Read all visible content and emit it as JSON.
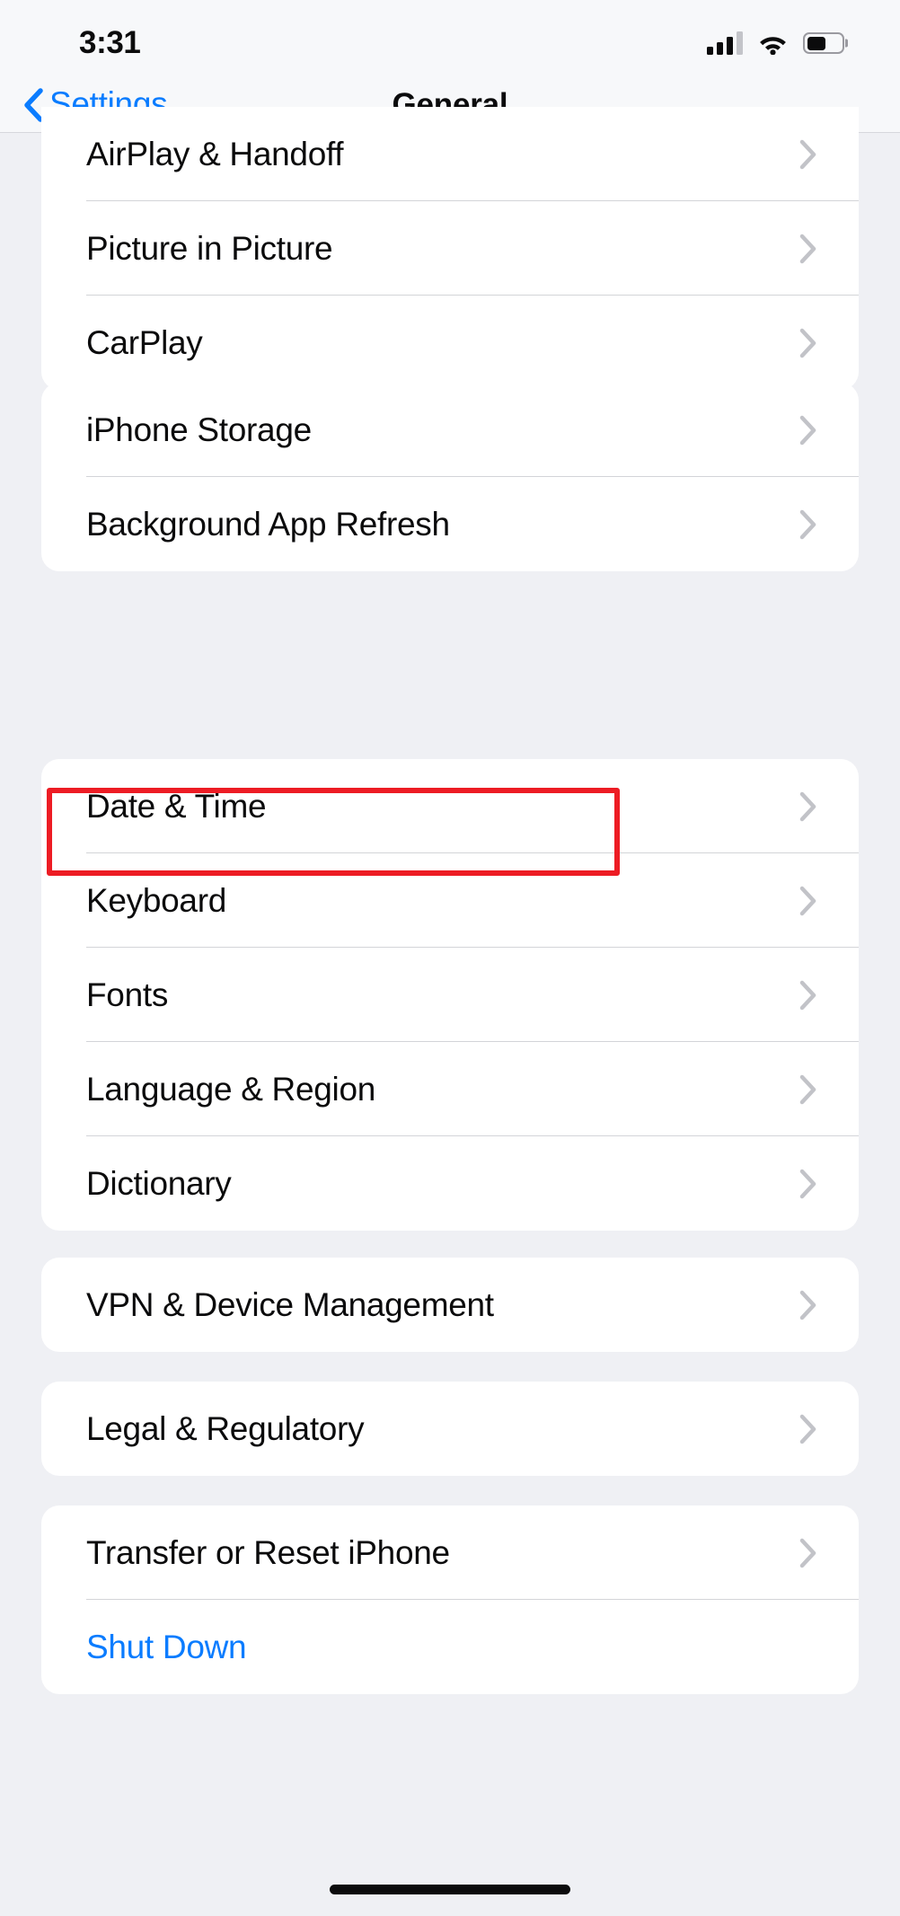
{
  "status_bar": {
    "time": "3:31",
    "cellular_icon": "cellular-signal-icon",
    "cellular_bars_filled": 3,
    "cellular_bars_total": 4,
    "wifi_icon": "wifi-icon",
    "battery_icon": "battery-icon",
    "battery_percent": 55
  },
  "nav": {
    "back_icon": "chevron-left-icon",
    "back_label": "Settings",
    "title": "General"
  },
  "colors": {
    "accent_blue": "#0a7cff",
    "highlight_red": "#ed1c24",
    "page_background": "#eff0f4",
    "card_background": "#ffffff"
  },
  "highlight": {
    "target_label": "Date & Time",
    "color": "#ed1c24"
  },
  "groups": [
    {
      "name": "media-group",
      "rows": [
        {
          "label": "AirPlay & Handoff",
          "accessory": "chevron-right-icon",
          "style": "default"
        },
        {
          "label": "Picture in Picture",
          "accessory": "chevron-right-icon",
          "style": "default"
        },
        {
          "label": "CarPlay",
          "accessory": "chevron-right-icon",
          "style": "default"
        }
      ]
    },
    {
      "name": "storage-group",
      "rows": [
        {
          "label": "iPhone Storage",
          "accessory": "chevron-right-icon",
          "style": "default"
        },
        {
          "label": "Background App Refresh",
          "accessory": "chevron-right-icon",
          "style": "default"
        }
      ]
    },
    {
      "name": "system-preferences-group",
      "rows": [
        {
          "label": "Date & Time",
          "accessory": "chevron-right-icon",
          "style": "default"
        },
        {
          "label": "Keyboard",
          "accessory": "chevron-right-icon",
          "style": "default"
        },
        {
          "label": "Fonts",
          "accessory": "chevron-right-icon",
          "style": "default"
        },
        {
          "label": "Language & Region",
          "accessory": "chevron-right-icon",
          "style": "default"
        },
        {
          "label": "Dictionary",
          "accessory": "chevron-right-icon",
          "style": "default"
        }
      ]
    },
    {
      "name": "vpn-group",
      "rows": [
        {
          "label": "VPN & Device Management",
          "accessory": "chevron-right-icon",
          "style": "default"
        }
      ]
    },
    {
      "name": "legal-group",
      "rows": [
        {
          "label": "Legal & Regulatory",
          "accessory": "chevron-right-icon",
          "style": "default"
        }
      ]
    },
    {
      "name": "reset-group",
      "rows": [
        {
          "label": "Transfer or Reset iPhone",
          "accessory": "chevron-right-icon",
          "style": "default"
        },
        {
          "label": "Shut Down",
          "accessory": "none",
          "style": "blue"
        }
      ]
    }
  ],
  "home_indicator": "home-indicator"
}
